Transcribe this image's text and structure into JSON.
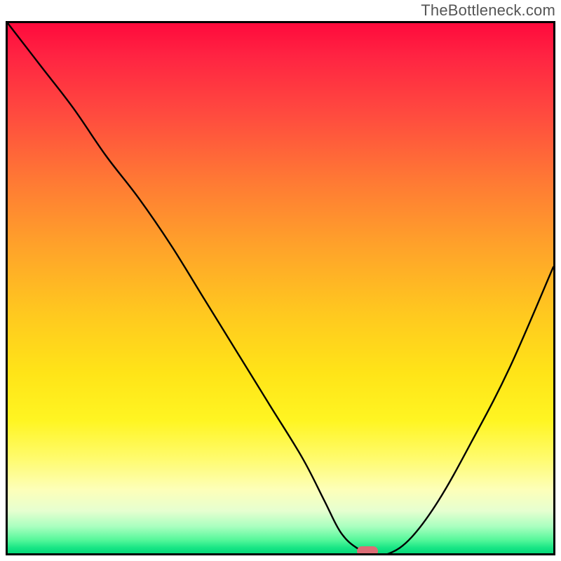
{
  "watermark": "TheBottleneck.com",
  "chart_data": {
    "type": "line",
    "title": "",
    "xlabel": "",
    "ylabel": "",
    "xlim": [
      0,
      100
    ],
    "ylim": [
      0,
      100
    ],
    "grid": false,
    "legend": false,
    "background": "rainbow-gradient (red at top through orange/yellow to green at bottom)",
    "series": [
      {
        "name": "bottleneck-curve",
        "color": "#000000",
        "x": [
          0,
          6,
          12,
          18,
          24,
          30,
          36,
          42,
          48,
          54,
          58,
          61,
          64,
          67,
          70,
          74,
          79,
          85,
          92,
          100
        ],
        "values": [
          100,
          92,
          84,
          75,
          67,
          58,
          48,
          38,
          28,
          18,
          10,
          4,
          1,
          0,
          0,
          3,
          10,
          21,
          35,
          54
        ]
      }
    ],
    "marker": {
      "name": "optimal-point",
      "x": 66,
      "y": 0,
      "color": "#dc6d76"
    }
  }
}
